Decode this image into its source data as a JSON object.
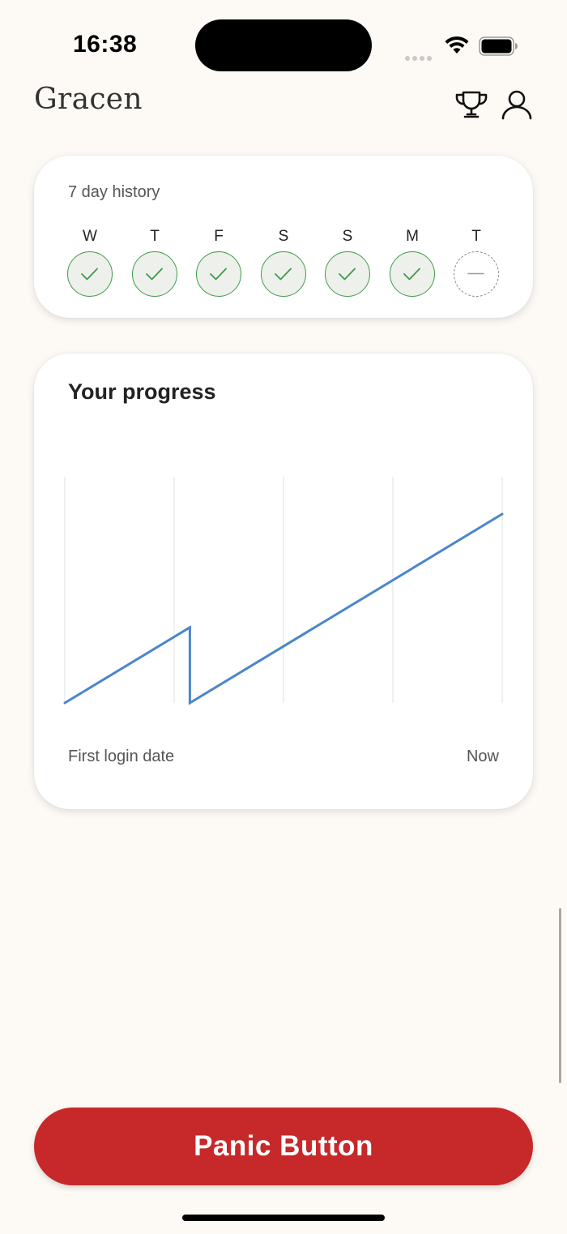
{
  "status_bar": {
    "time": "16:38",
    "icons": [
      "signal-icon",
      "wifi-icon",
      "battery-icon"
    ]
  },
  "header": {
    "app_title": "Gracen",
    "icons": [
      "trophy-icon",
      "profile-icon"
    ]
  },
  "history": {
    "title": "7 day history",
    "days": [
      {
        "label": "W",
        "status": "done"
      },
      {
        "label": "T",
        "status": "done"
      },
      {
        "label": "F",
        "status": "done"
      },
      {
        "label": "S",
        "status": "done"
      },
      {
        "label": "S",
        "status": "done"
      },
      {
        "label": "M",
        "status": "done"
      },
      {
        "label": "T",
        "status": "pending"
      }
    ],
    "colors": {
      "done_border": "#3f9a4a",
      "done_fill": "#eef0eb",
      "pending_border": "#888888"
    }
  },
  "progress": {
    "title": "Your progress",
    "x_start_label": "First login date",
    "x_end_label": "Now",
    "line_color": "#4a86cc"
  },
  "chart_data": {
    "type": "line",
    "title": "Your progress",
    "xlabel": "",
    "ylabel": "",
    "x_tick_labels": [
      "First login date",
      "Now"
    ],
    "x": [
      0,
      0.286,
      0.286,
      1.0
    ],
    "y": [
      0,
      0.4,
      0,
      1.0
    ],
    "xlim": [
      0,
      1
    ],
    "ylim": [
      0,
      1
    ],
    "grid": "vertical",
    "series": [
      {
        "values": [
          0,
          0.4,
          0,
          1.0
        ]
      }
    ]
  },
  "panic": {
    "label": "Panic Button",
    "color": "#c7282a"
  }
}
